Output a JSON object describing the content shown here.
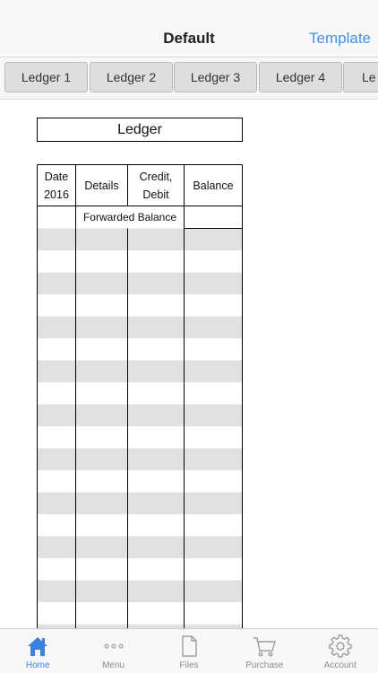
{
  "header": {
    "title": "Default",
    "template_label": "Template"
  },
  "ledger_tabs": [
    {
      "label": "Ledger 1"
    },
    {
      "label": "Ledger 2"
    },
    {
      "label": "Ledger 3"
    },
    {
      "label": "Ledger 4"
    },
    {
      "label": "Le"
    }
  ],
  "sheet": {
    "title": "Ledger",
    "columns": [
      {
        "label": "Date\n2016"
      },
      {
        "label": "Details"
      },
      {
        "label": "Credit,\nDebit"
      },
      {
        "label": "Balance"
      }
    ],
    "forwarded_label": "Forwarded Balance"
  },
  "tabbar": {
    "items": [
      {
        "label": "Home",
        "icon": "home-icon",
        "active": true
      },
      {
        "label": "Menu",
        "icon": "more-dots-icon",
        "active": false
      },
      {
        "label": "Files",
        "icon": "file-icon",
        "active": false
      },
      {
        "label": "Purchase",
        "icon": "cart-icon",
        "active": false
      },
      {
        "label": "Account",
        "icon": "gear-icon",
        "active": false
      }
    ]
  },
  "colors": {
    "accent": "#3b82e0",
    "template_link": "#4a8fe0",
    "row_stripe": "#e1e1e1"
  }
}
